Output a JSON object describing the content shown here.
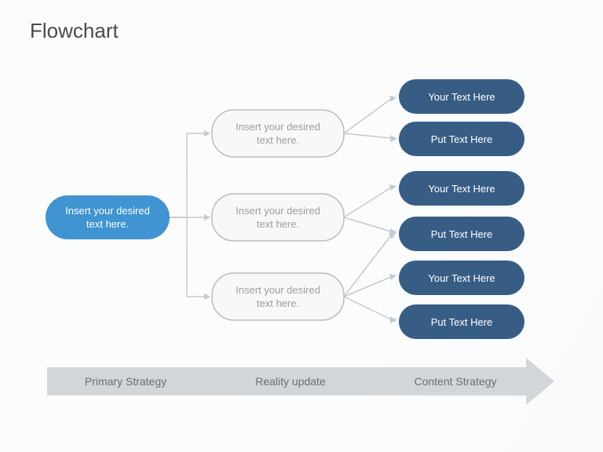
{
  "title": "Flowchart",
  "root": {
    "line1": "Insert your desired",
    "line2": "text here."
  },
  "mid": [
    {
      "line1": "Insert your desired",
      "line2": "text here."
    },
    {
      "line1": "Insert your desired",
      "line2": "text here."
    },
    {
      "line1": "Insert your desired",
      "line2": "text here."
    }
  ],
  "leaves": [
    "Your Text Here",
    "Put Text Here",
    "Your Text Here",
    "Put Text Here",
    "Your Text Here",
    "Put Text Here"
  ],
  "axis": [
    "Primary Strategy",
    "Reality update",
    "Content Strategy"
  ]
}
